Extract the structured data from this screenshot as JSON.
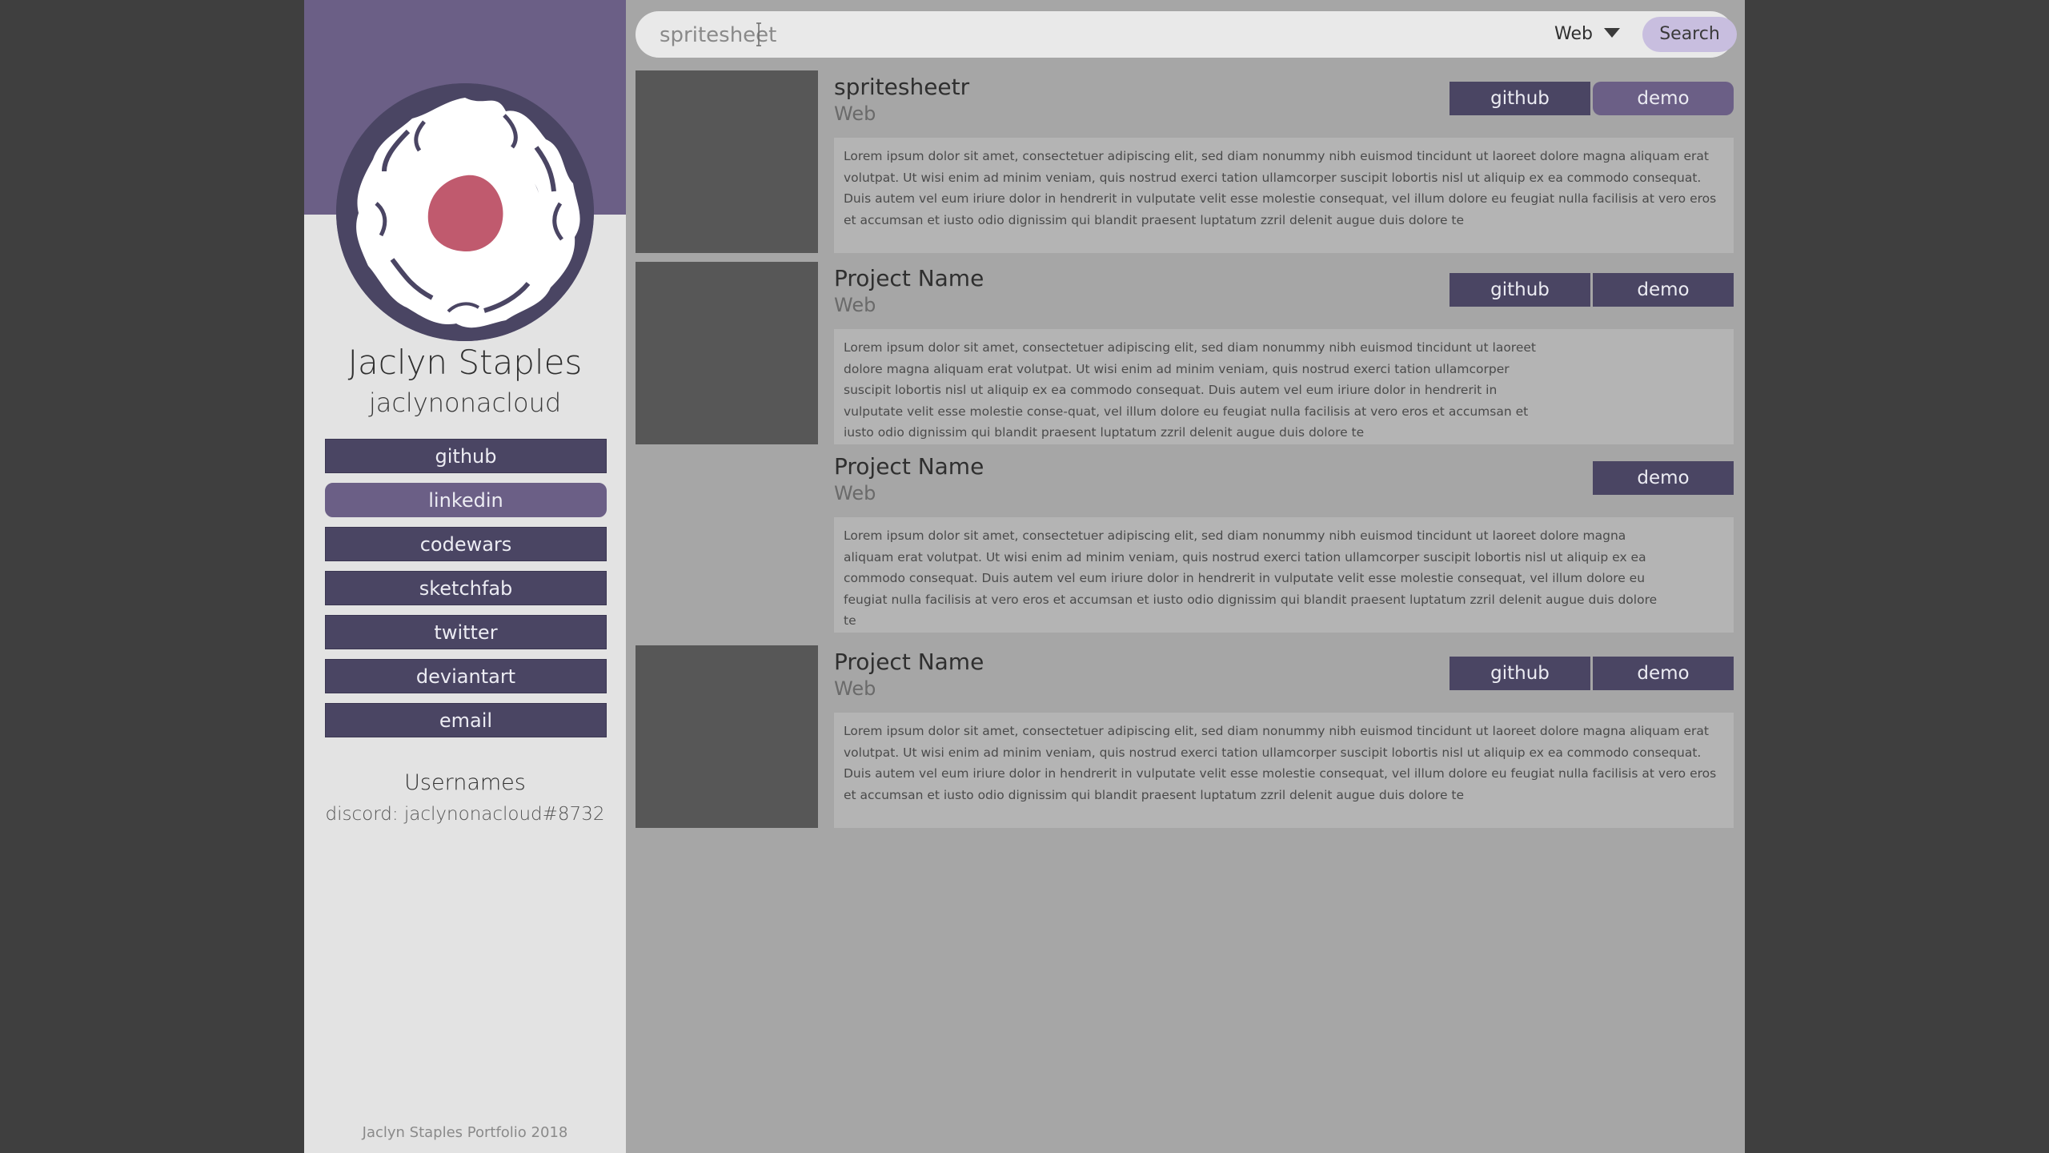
{
  "profile": {
    "name": "Jaclyn Staples",
    "handle": "jaclynonacloud"
  },
  "social": [
    {
      "label": "github",
      "active": false
    },
    {
      "label": "linkedin",
      "active": true
    },
    {
      "label": "codewars",
      "active": false
    },
    {
      "label": "sketchfab",
      "active": false
    },
    {
      "label": "twitter",
      "active": false
    },
    {
      "label": "deviantart",
      "active": false
    },
    {
      "label": "email",
      "active": false
    }
  ],
  "usernames": {
    "title": "Usernames",
    "discord": "discord: jaclynonacloud#8732"
  },
  "footer": "Jaclyn Staples Portfolio 2018",
  "search": {
    "value": "spritesheet",
    "filter": "Web",
    "button": "Search"
  },
  "projects": [
    {
      "title": "spritesheetr",
      "category": "Web",
      "github": "github",
      "demo": "demo",
      "description": "Lorem ipsum dolor sit amet, consectetuer adipiscing elit, sed diam nonummy nibh euismod tincidunt ut laoreet dolore magna aliquam erat volutpat. Ut wisi enim ad minim veniam, quis nostrud exerci tation ullamcorper suscipit lobortis nisl ut aliquip ex ea commodo consequat. Duis autem vel eum iriure dolor in hendrerit in vulputate velit esse molestie consequat, vel illum dolore eu feugiat nulla facilisis at vero eros et accumsan et iusto odio dignissim qui blandit praesent luptatum zzril delenit augue duis dolore te"
    },
    {
      "title": "Project Name",
      "category": "Web",
      "github": "github",
      "demo": "demo",
      "description": "Lorem ipsum dolor sit amet, consectetuer adipiscing elit, sed diam nonummy nibh euismod tincidunt ut laoreet dolore magna aliquam erat volutpat. Ut wisi enim ad minim veniam, quis nostrud exerci tation ullamcorper suscipit lobortis nisl ut aliquip ex ea commodo consequat. Duis autem vel eum iriure dolor in hendrerit in vulputate velit esse molestie conse-quat, vel illum dolore eu feugiat nulla facilisis at vero eros et accumsan et iusto odio dignissim qui blandit praesent luptatum zzril delenit augue duis dolore te"
    },
    {
      "title": "Project Name",
      "category": "Web",
      "demo": "demo",
      "description": "Lorem ipsum dolor sit amet, consectetuer adipiscing elit, sed diam nonummy nibh euismod tincidunt ut laoreet dolore magna aliquam erat volutpat. Ut wisi enim ad minim veniam, quis nostrud exerci tation ullamcorper suscipit lobortis nisl ut aliquip ex ea commodo consequat. Duis autem vel eum iriure dolor in hendrerit in vulputate velit esse molestie consequat, vel illum dolore eu feugiat nulla facilisis at vero eros et accumsan et iusto odio dignissim qui blandit praesent luptatum zzril delenit augue duis dolore te"
    },
    {
      "title": "Project Name",
      "category": "Web",
      "github": "github",
      "demo": "demo",
      "description": "Lorem ipsum dolor sit amet, consectetuer adipiscing elit, sed diam nonummy nibh euismod tincidunt ut laoreet dolore magna aliquam erat volutpat. Ut wisi enim ad minim veniam, quis nostrud exerci tation ullamcorper suscipit lobortis nisl ut aliquip ex ea commodo consequat. Duis autem vel eum iriure dolor in hendrerit in vulputate velit esse molestie consequat, vel illum dolore eu feugiat nulla facilisis at vero eros et accumsan et iusto odio dignissim qui blandit praesent luptatum zzril delenit augue duis dolore te"
    }
  ],
  "colors": {
    "background": "#3f3f3f",
    "sidebar": "#e3e3e3",
    "banner": "#6b5f86",
    "button": "#4a4563",
    "button_active": "#6b5f86",
    "main": "#a6a6a6",
    "thumbnail": "#575757",
    "accent_logo": "#c05a6e"
  }
}
